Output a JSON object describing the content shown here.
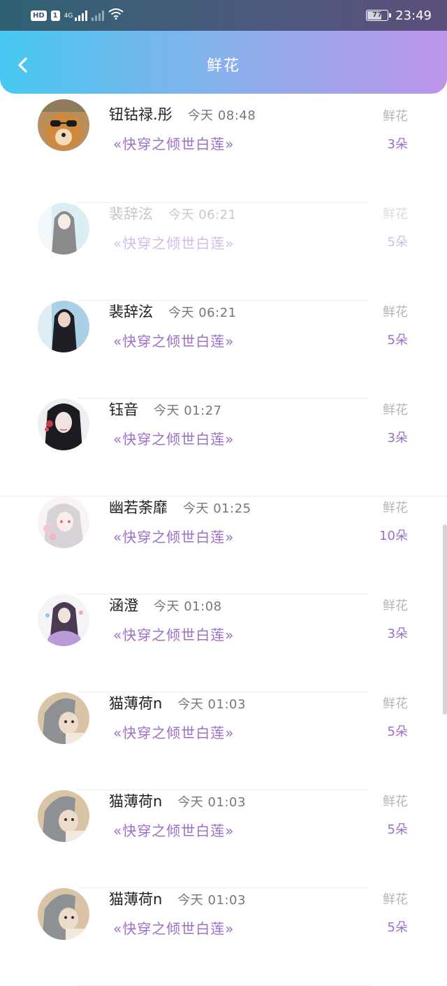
{
  "status_bar": {
    "hd": "HD",
    "sim": "1",
    "net": "4G",
    "battery": "77",
    "time": "23:49"
  },
  "header": {
    "title": "鲜花"
  },
  "gifts": [
    {
      "name": "钮钴禄.彤",
      "time": "今天 08:48",
      "book": "«快穿之倾世白莲»",
      "label": "鲜花",
      "count": "3朵"
    },
    {
      "name": "裴辞泫",
      "time": "今天 06:21",
      "book": "«快穿之倾世白莲»",
      "label": "鲜花",
      "count": "5朵"
    },
    {
      "name": "裴辞泫",
      "time": "今天 06:21",
      "book": "«快穿之倾世白莲»",
      "label": "鲜花",
      "count": "5朵"
    },
    {
      "name": "钰音",
      "time": "今天 01:27",
      "book": "«快穿之倾世白莲»",
      "label": "鲜花",
      "count": "3朵"
    },
    {
      "name": "幽若荼靡",
      "time": "今天 01:25",
      "book": "«快穿之倾世白莲»",
      "label": "鲜花",
      "count": "10朵"
    },
    {
      "name": "涵澄",
      "time": "今天 01:08",
      "book": "«快穿之倾世白莲»",
      "label": "鲜花",
      "count": "3朵"
    },
    {
      "name": "猫薄荷n",
      "time": "今天 01:03",
      "book": "«快穿之倾世白莲»",
      "label": "鲜花",
      "count": "5朵"
    },
    {
      "name": "猫薄荷n",
      "time": "今天 01:03",
      "book": "«快穿之倾世白莲»",
      "label": "鲜花",
      "count": "5朵"
    },
    {
      "name": "猫薄荷n",
      "time": "今天 01:03",
      "book": "«快穿之倾世白莲»",
      "label": "鲜花",
      "count": "5朵"
    }
  ],
  "colors": {
    "accent": "#9b6fc8",
    "header_start": "#46c9f0",
    "header_end": "#bd95e8"
  }
}
